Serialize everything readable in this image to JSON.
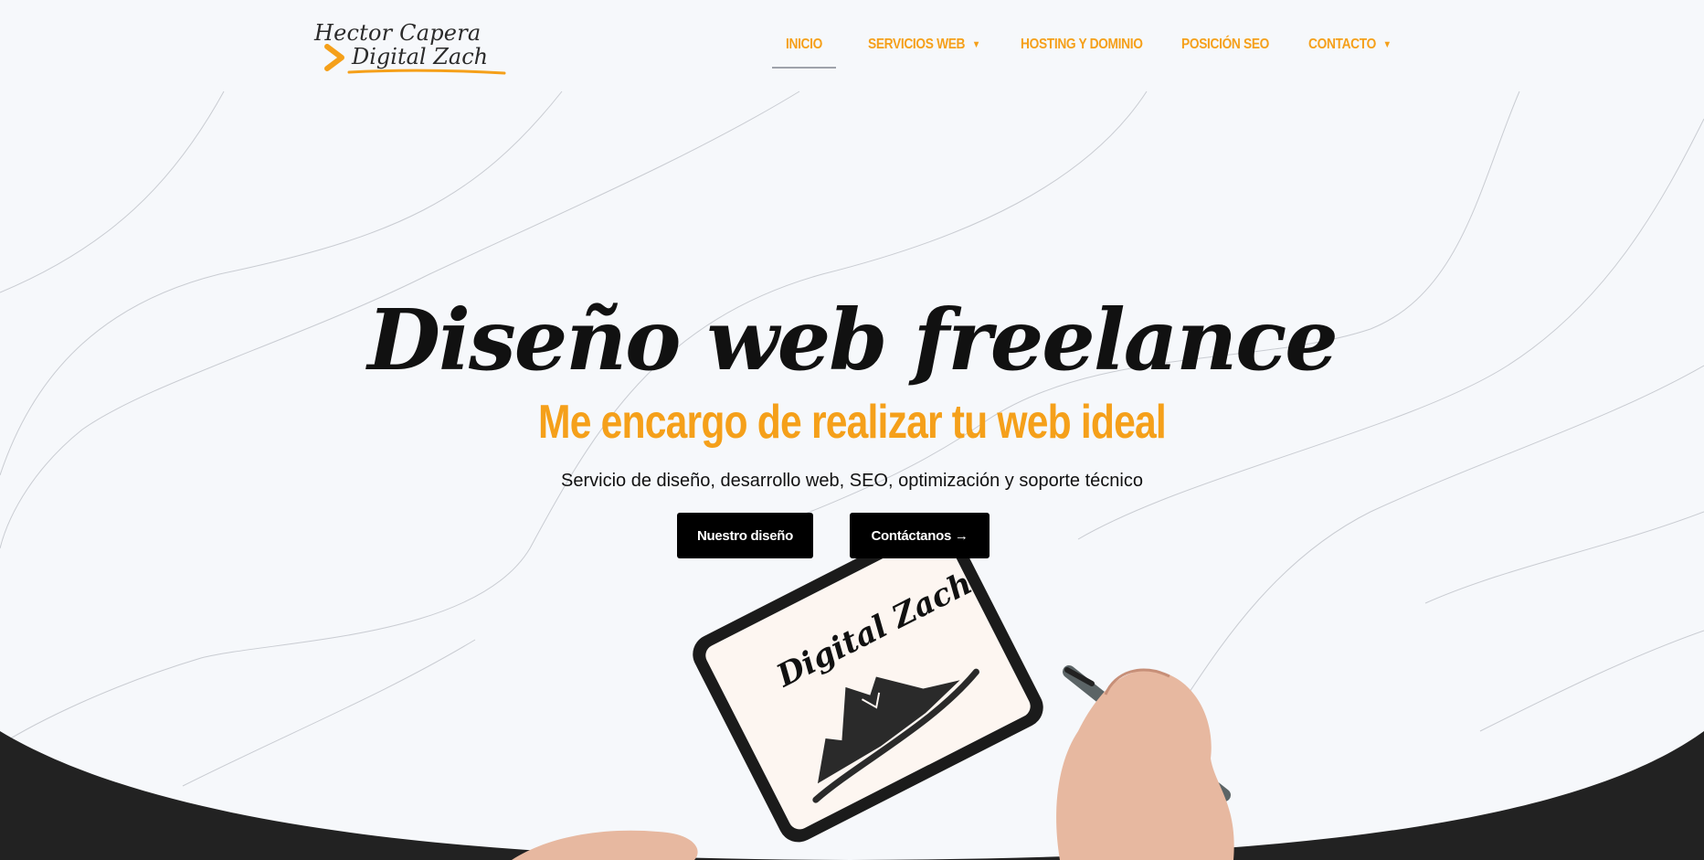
{
  "header": {
    "logo_line1": "Hector Capera",
    "logo_line2": "Digital Zach",
    "nav": [
      {
        "label": "INICIO",
        "active": true
      },
      {
        "label": "SERVICIOS WEB",
        "dropdown": true
      },
      {
        "label": "HOSTING Y DOMINIO"
      },
      {
        "label": "POSICIÓN SEO"
      },
      {
        "label": "CONTACTO",
        "dropdown": true
      }
    ]
  },
  "hero": {
    "title": "Diseño web freelance",
    "subtitle": "Me encargo de realizar tu web ideal",
    "description": "Servicio de diseño, desarrollo web, SEO, optimización y soporte técnico",
    "button_primary": "Nuestro diseño",
    "button_secondary": "Contáctanos →"
  },
  "tablet": {
    "screen_text": "Digital Zach"
  },
  "colors": {
    "accent": "#f5a01a",
    "background": "#f6f8fb",
    "dark": "#222222",
    "button": "#000000"
  },
  "icons": {
    "caret": "caret-down-icon",
    "logo_chevron": "chevron-right-icon"
  }
}
